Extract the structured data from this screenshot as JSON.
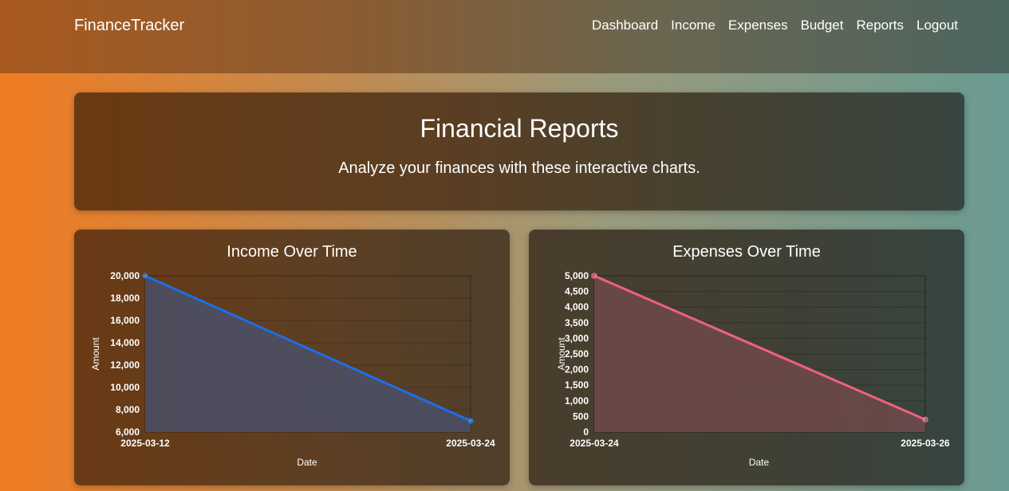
{
  "nav": {
    "brand": "FinanceTracker",
    "links": [
      "Dashboard",
      "Income",
      "Expenses",
      "Budget",
      "Reports",
      "Logout"
    ]
  },
  "hero": {
    "title": "Financial Reports",
    "subtitle": "Analyze your finances with these interactive charts."
  },
  "chart_data": [
    {
      "type": "line",
      "title": "Income Over Time",
      "x": [
        "2025-03-12",
        "2025-03-24"
      ],
      "values": [
        20000,
        7000
      ],
      "xlabel": "Date",
      "ylabel": "Amount",
      "ylim": [
        6000,
        20000
      ],
      "yticks": [
        "20,000",
        "18,000",
        "16,000",
        "14,000",
        "12,000",
        "10,000",
        "8,000",
        "6,000"
      ],
      "line_color": "#1a6fe8",
      "fill_color": "#4a5068",
      "grid": true
    },
    {
      "type": "line",
      "title": "Expenses Over Time",
      "x": [
        "2025-03-24",
        "2025-03-26"
      ],
      "values": [
        5000,
        400
      ],
      "xlabel": "Date",
      "ylabel": "Amount",
      "ylim": [
        0,
        5000
      ],
      "yticks": [
        "5,000",
        "4,500",
        "4,000",
        "3,500",
        "3,000",
        "2,500",
        "2,000",
        "1,500",
        "1,000",
        "500",
        "0"
      ],
      "line_color": "#f0607e",
      "fill_color": "#6e4a4a",
      "grid": true
    }
  ]
}
